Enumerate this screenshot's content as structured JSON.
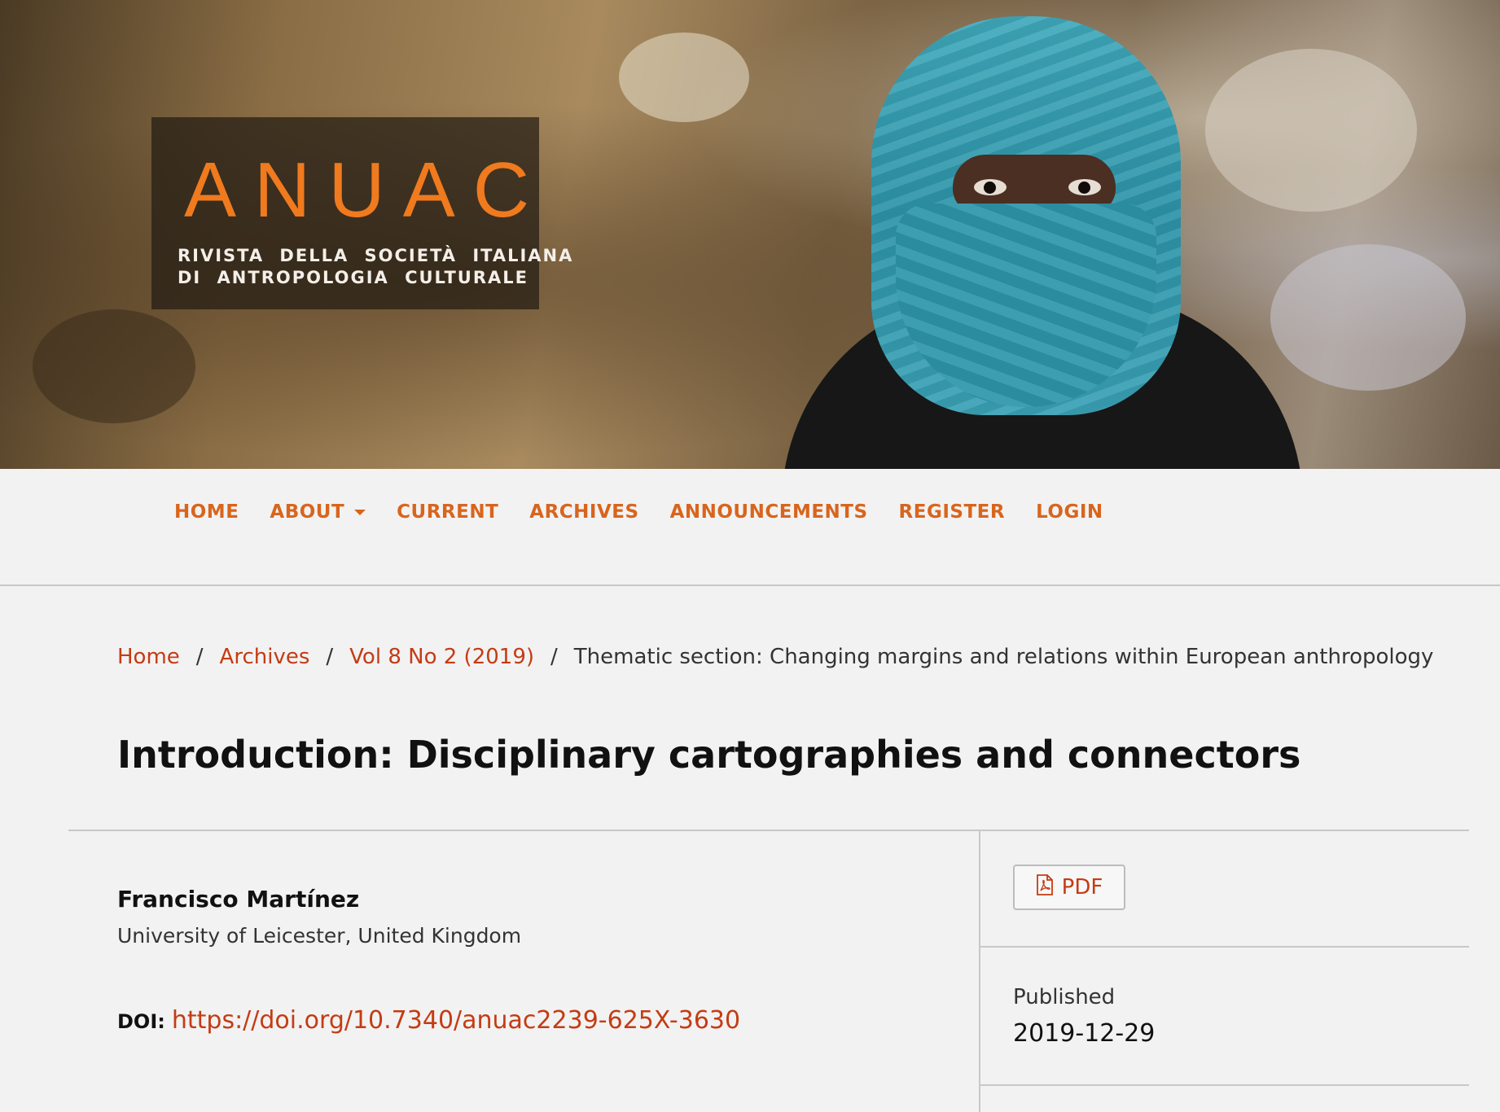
{
  "header": {
    "logo_title": "ANUAC",
    "logo_subtitle_line1": "RIVISTA DELLA SOCIETÀ ITALIANA",
    "logo_subtitle_line2": "DI ANTROPOLOGIA CULTURALE"
  },
  "nav": {
    "items": [
      {
        "label": "HOME"
      },
      {
        "label": "ABOUT",
        "has_dropdown": true
      },
      {
        "label": "CURRENT"
      },
      {
        "label": "ARCHIVES"
      },
      {
        "label": "ANNOUNCEMENTS"
      },
      {
        "label": "REGISTER"
      },
      {
        "label": "LOGIN"
      }
    ]
  },
  "breadcrumb": {
    "items": [
      {
        "label": "Home"
      },
      {
        "label": "Archives"
      },
      {
        "label": "Vol 8 No 2 (2019)"
      },
      {
        "label": "Thematic section: Changing margins and relations within European anthropology"
      }
    ],
    "separator": "/"
  },
  "article": {
    "title": "Introduction: Disciplinary cartographies and connectors",
    "author_name": "Francisco Martínez",
    "author_affiliation": "University of Leicester, United Kingdom",
    "doi_label": "DOI:",
    "doi_url": "https://doi.org/10.7340/anuac2239-625X-3630"
  },
  "sidebar": {
    "pdf_label": "PDF",
    "published_label": "Published",
    "published_date": "2019-12-29"
  },
  "colors": {
    "accent": "#d8651d",
    "link": "#c43c13",
    "background": "#f2f2f2"
  },
  "icons": [
    "pdf-icon",
    "chevron-down-icon"
  ]
}
